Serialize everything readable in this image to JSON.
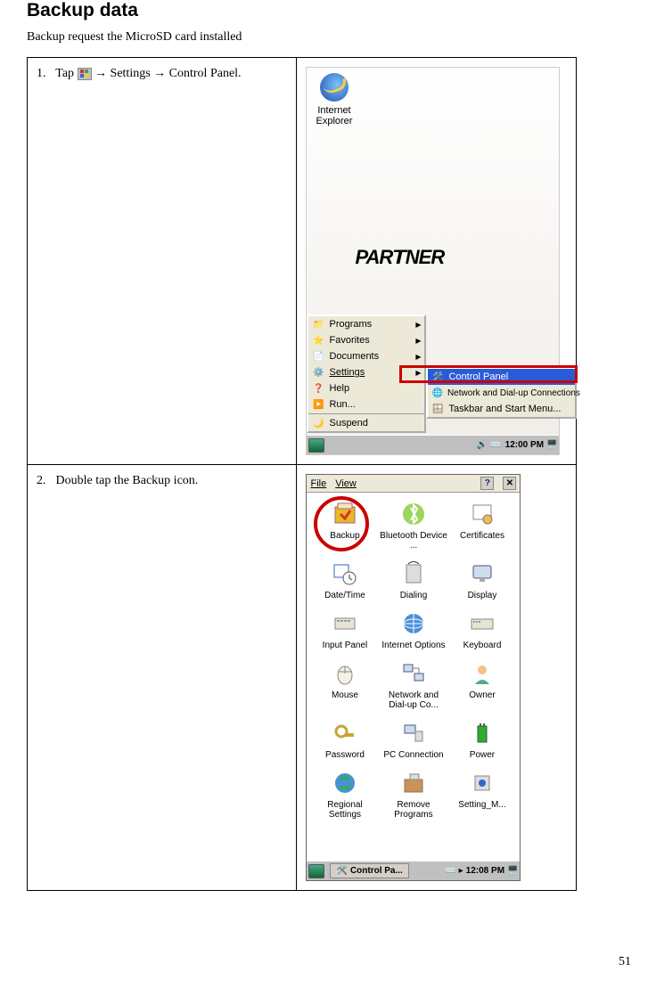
{
  "title": "Backup data",
  "subtitle": "Backup request the MicroSD card installed",
  "page_number": "51",
  "steps": [
    {
      "num": "1.",
      "prefix": "Tap ",
      "suffix": " → Settings → Control Panel."
    },
    {
      "num": "2.",
      "text": "Double tap the Backup icon."
    }
  ],
  "shot1": {
    "ie_label": "Internet\nExplorer",
    "partner_logo": "PARTNER",
    "start_menu": [
      "Programs",
      "Favorites",
      "Documents",
      "Settings",
      "Help",
      "Run..."
    ],
    "suspend": "Suspend",
    "submenu": [
      "Control Panel",
      "Network and Dial-up Connections",
      "Taskbar and Start Menu..."
    ],
    "time": "12:00 PM"
  },
  "shot2": {
    "menu": {
      "file": "File",
      "view": "View"
    },
    "items": [
      "Backup",
      "Bluetooth Device ...",
      "Certificates",
      "Date/Time",
      "Dialing",
      "Display",
      "Input Panel",
      "Internet Options",
      "Keyboard",
      "Mouse",
      "Network and Dial-up Co...",
      "Owner",
      "Password",
      "PC Connection",
      "Power",
      "Regional Settings",
      "Remove Programs",
      "Setting_M..."
    ],
    "taskbar_label": "Control Pa...",
    "time": "12:08 PM"
  }
}
